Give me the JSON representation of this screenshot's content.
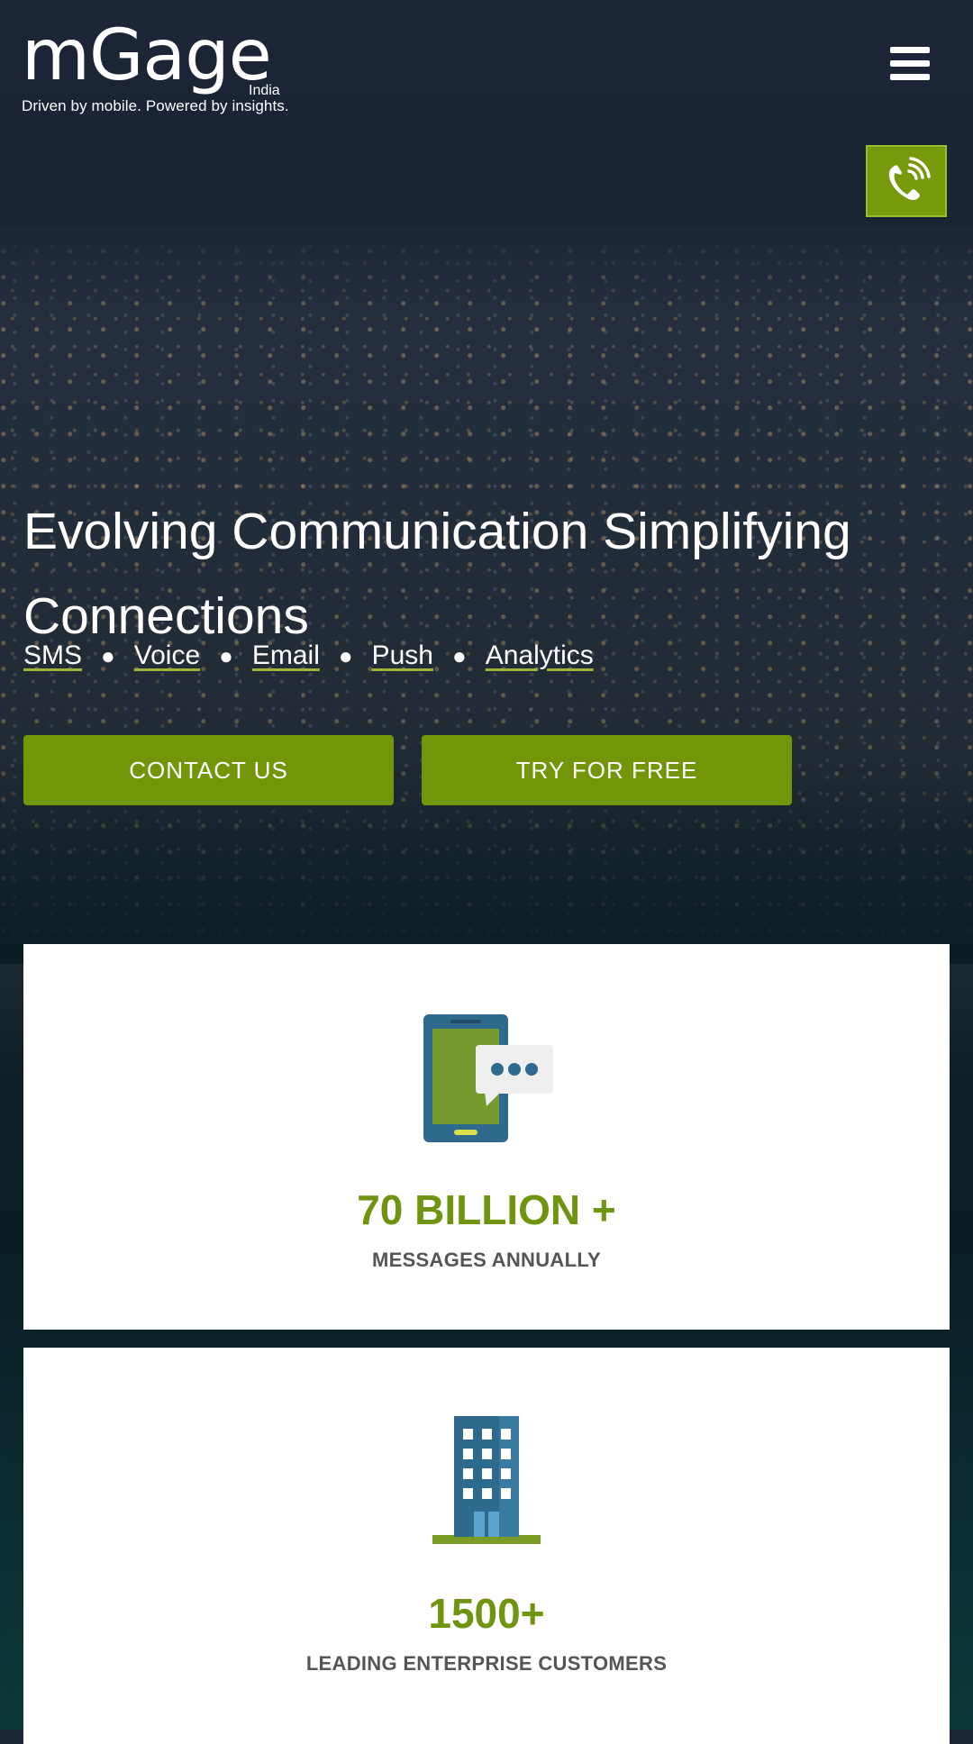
{
  "header": {
    "logo_text": "mGage",
    "logo_region": "India",
    "tagline": "Driven by mobile. Powered by insights.",
    "menu_icon": "hamburger-menu-icon",
    "call_icon": "phone-call-icon"
  },
  "hero": {
    "title": "Evolving Communication Simplifying Connections",
    "services": [
      "SMS",
      "Voice",
      "Email",
      "Push",
      "Analytics"
    ],
    "contact_label": "CONTACT US",
    "try_label": "TRY FOR FREE"
  },
  "stats": [
    {
      "icon": "mobile-message-icon",
      "value": "70 BILLION +",
      "label": "MESSAGES ANNUALLY"
    },
    {
      "icon": "office-building-icon",
      "value": "1500+",
      "label": "LEADING ENTERPRISE CUSTOMERS"
    }
  ],
  "colors": {
    "accent_green": "#739608",
    "stat_green": "#6e9410",
    "icon_blue": "#2e6a8e"
  }
}
